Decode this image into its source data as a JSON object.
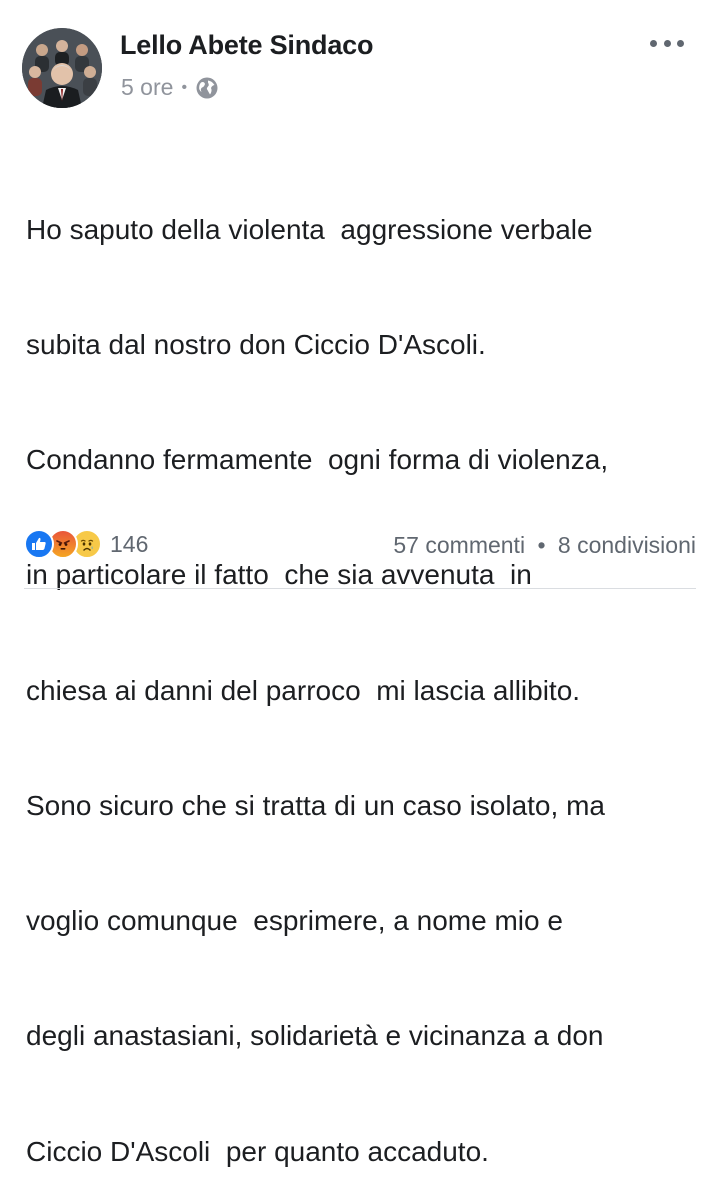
{
  "post": {
    "author": "Lello Abete Sindaco",
    "time": "5 ore",
    "separator": "•",
    "audience_icon": "globe-icon",
    "more_icon": "more-options-icon",
    "text_lines": [
      "Ho saputo della violenta  aggressione verbale",
      "subita dal nostro don Ciccio D'Ascoli.",
      "Condanno fermamente  ogni forma di violenza,",
      "in particolare il fatto  che sia avvenuta  in",
      "chiesa ai danni del parroco  mi lascia allibito.",
      "Sono sicuro che si tratta di un caso isolato, ma",
      "voglio comunque  esprimere, a nome mio e",
      "degli anastasiani, solidarietà e vicinanza a don",
      "Ciccio D'Ascoli  per quanto accaduto."
    ]
  },
  "footer": {
    "reactions": [
      "like-reaction-icon",
      "angry-reaction-icon",
      "sad-reaction-icon"
    ],
    "reaction_count": "146",
    "comments": "57 commenti",
    "separator": "•",
    "shares": "8 condivisioni"
  },
  "colors": {
    "text": "#1c1e21",
    "secondary": "#90949c",
    "like_blue": "#1877f2",
    "divider": "#dadde1"
  }
}
